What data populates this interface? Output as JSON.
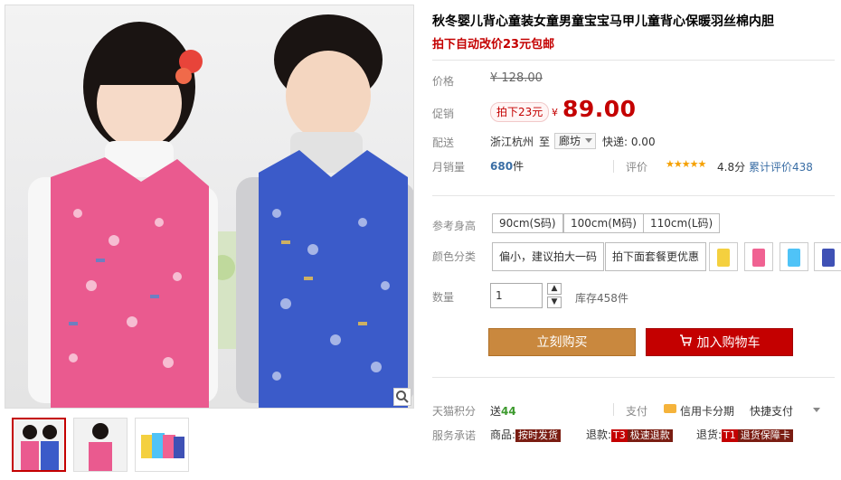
{
  "product": {
    "title": "秋冬婴儿背心童装女童男童宝宝马甲儿童背心保暖羽丝棉内胆",
    "subtitle": "拍下自动改价23元包邮"
  },
  "price": {
    "label": "价格",
    "original": "¥ 128.00",
    "promo_label": "促销",
    "promo_tag": "拍下23元",
    "currency": "¥",
    "promo_price": "89.00"
  },
  "shipping": {
    "label": "配送",
    "from": "浙江杭州",
    "to_label": "至",
    "destination": "廊坊",
    "express": "快递: 0.00"
  },
  "sales": {
    "label": "月销量",
    "count": "680",
    "unit": "件",
    "rating_label": "评价",
    "stars": "★★★★★",
    "score": "4.8分",
    "review_count": "累计评价438"
  },
  "options": {
    "height_label": "参考身高",
    "heights": [
      "90cm(S码)",
      "100cm(M码)",
      "110cm(L码)"
    ],
    "color_label": "颜色分类",
    "colors": [
      "偏小，建议拍大一码",
      "拍下面套餐更优惠"
    ],
    "swatch_colors": [
      "#f4d03f",
      "#f06292",
      "#4fc3f7",
      "#3f51b5"
    ]
  },
  "quantity": {
    "label": "数量",
    "value": "1",
    "stock": "库存458件"
  },
  "buttons": {
    "buy": "立刻购买",
    "cart": "加入购物车"
  },
  "points": {
    "label": "天猫积分",
    "send": "送",
    "value": "44",
    "pay_label": "支付",
    "card": "信用卡分期",
    "quick": "快捷支付"
  },
  "service": {
    "label": "服务承诺",
    "goods": "商品:",
    "goods_badge": "按时发货",
    "refund": "退款:",
    "refund_t3": "T3",
    "refund_badge": "极速退款",
    "return": "退货:",
    "return_t1": "T1",
    "return_badge": "退货保障卡"
  },
  "colors": {
    "brand_red": "#c40000",
    "buy_orange": "#c9883e"
  }
}
